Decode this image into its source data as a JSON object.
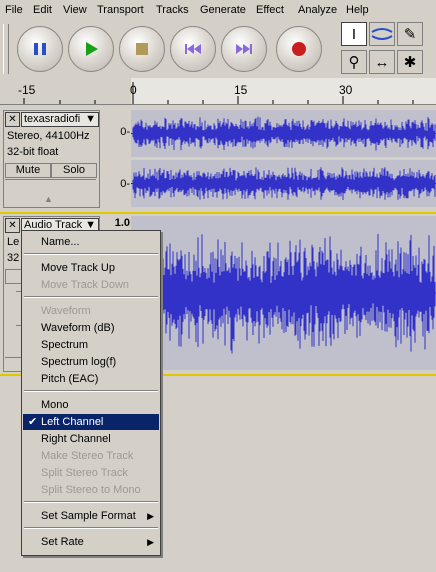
{
  "menubar": {
    "items": [
      "File",
      "Edit",
      "View",
      "Transport",
      "Tracks",
      "Generate",
      "Effect",
      "Analyze",
      "Help"
    ]
  },
  "transport": {
    "buttons": [
      {
        "name": "pause",
        "icon": "pause-icon"
      },
      {
        "name": "play",
        "icon": "play-icon"
      },
      {
        "name": "stop",
        "icon": "stop-icon"
      },
      {
        "name": "skip-to-start",
        "icon": "skip-start-icon"
      },
      {
        "name": "skip-to-end",
        "icon": "skip-end-icon"
      },
      {
        "name": "record",
        "icon": "record-icon"
      }
    ]
  },
  "tools": {
    "items": [
      {
        "name": "selection-tool",
        "icon": "i-beam-icon",
        "glyph": "I",
        "selected": true
      },
      {
        "name": "envelope-tool",
        "icon": "envelope-icon",
        "glyph": "≈"
      },
      {
        "name": "draw-tool",
        "icon": "pencil-icon",
        "glyph": "✎"
      },
      {
        "name": "zoom-tool",
        "icon": "magnifier-icon",
        "glyph": "⚲"
      },
      {
        "name": "time-shift-tool",
        "icon": "time-shift-icon",
        "glyph": "↔"
      },
      {
        "name": "multi-tool",
        "icon": "multi-tool-icon",
        "glyph": "✱"
      }
    ]
  },
  "ruler": {
    "labels": [
      "-15",
      "0",
      "15",
      "30"
    ]
  },
  "track1": {
    "name": "texasradiofi",
    "info_line1": "Stereo, 44100Hz",
    "info_line2": "32-bit float",
    "mute_label": "Mute",
    "solo_label": "Solo",
    "scale_top": "0-",
    "scale_bottom": "0-"
  },
  "track2": {
    "name": "Audio Track",
    "scale_value": "1.0",
    "info_line1": "Le",
    "info_line2": "32"
  },
  "context_menu": {
    "items": [
      {
        "label": "Name...",
        "enabled": true
      },
      {
        "sep": true
      },
      {
        "label": "Move Track Up",
        "enabled": true
      },
      {
        "label": "Move Track Down",
        "enabled": false
      },
      {
        "sep": true
      },
      {
        "label": "Waveform",
        "enabled": false
      },
      {
        "label": "Waveform (dB)",
        "enabled": true
      },
      {
        "label": "Spectrum",
        "enabled": true
      },
      {
        "label": "Spectrum log(f)",
        "enabled": true
      },
      {
        "label": "Pitch (EAC)",
        "enabled": true
      },
      {
        "sep": true
      },
      {
        "label": "Mono",
        "enabled": true
      },
      {
        "label": "Left Channel",
        "enabled": true,
        "checked": true,
        "highlighted": true
      },
      {
        "label": "Right Channel",
        "enabled": true
      },
      {
        "label": "Make Stereo Track",
        "enabled": false
      },
      {
        "label": "Split Stereo Track",
        "enabled": false
      },
      {
        "label": "Split Stereo to Mono",
        "enabled": false
      },
      {
        "sep": true
      },
      {
        "label": "Set Sample Format",
        "enabled": true,
        "submenu": true
      },
      {
        "sep": true
      },
      {
        "label": "Set Rate",
        "enabled": true,
        "submenu": true
      }
    ]
  },
  "colors": {
    "background": "#d4d0c8",
    "wave_bg": "#c0c0cc",
    "wave_fg": "#3232c8",
    "selection": "#0a246a",
    "record": "#c81e1e",
    "play": "#18a018",
    "pause": "#2850c8"
  }
}
